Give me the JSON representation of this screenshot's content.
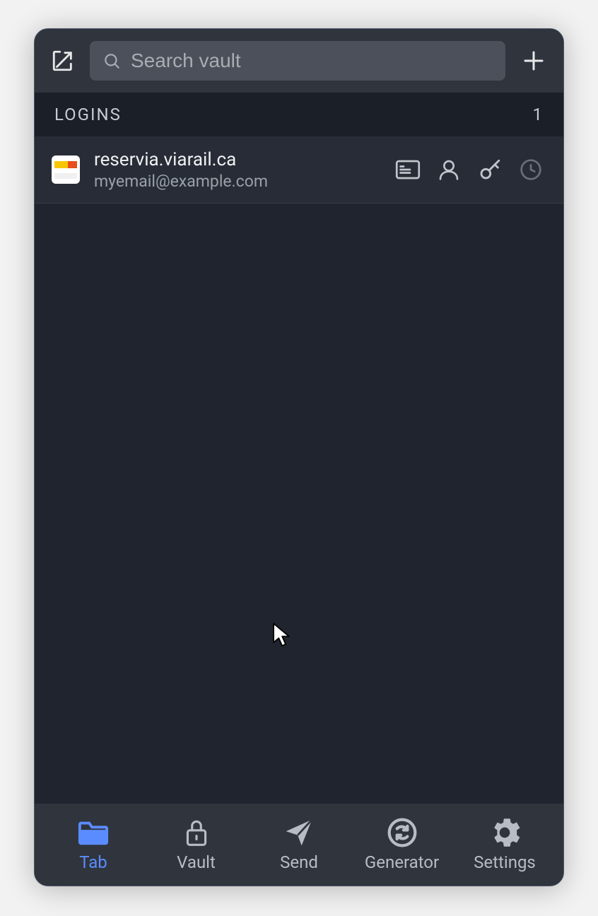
{
  "header": {
    "search_placeholder": "Search vault"
  },
  "section": {
    "title": "LOGINS",
    "count": "1"
  },
  "logins": [
    {
      "title": "reservia.viarail.ca",
      "subtitle": "myemail@example.com"
    }
  ],
  "nav": {
    "tab": "Tab",
    "vault": "Vault",
    "send": "Send",
    "generator": "Generator",
    "settings": "Settings"
  }
}
